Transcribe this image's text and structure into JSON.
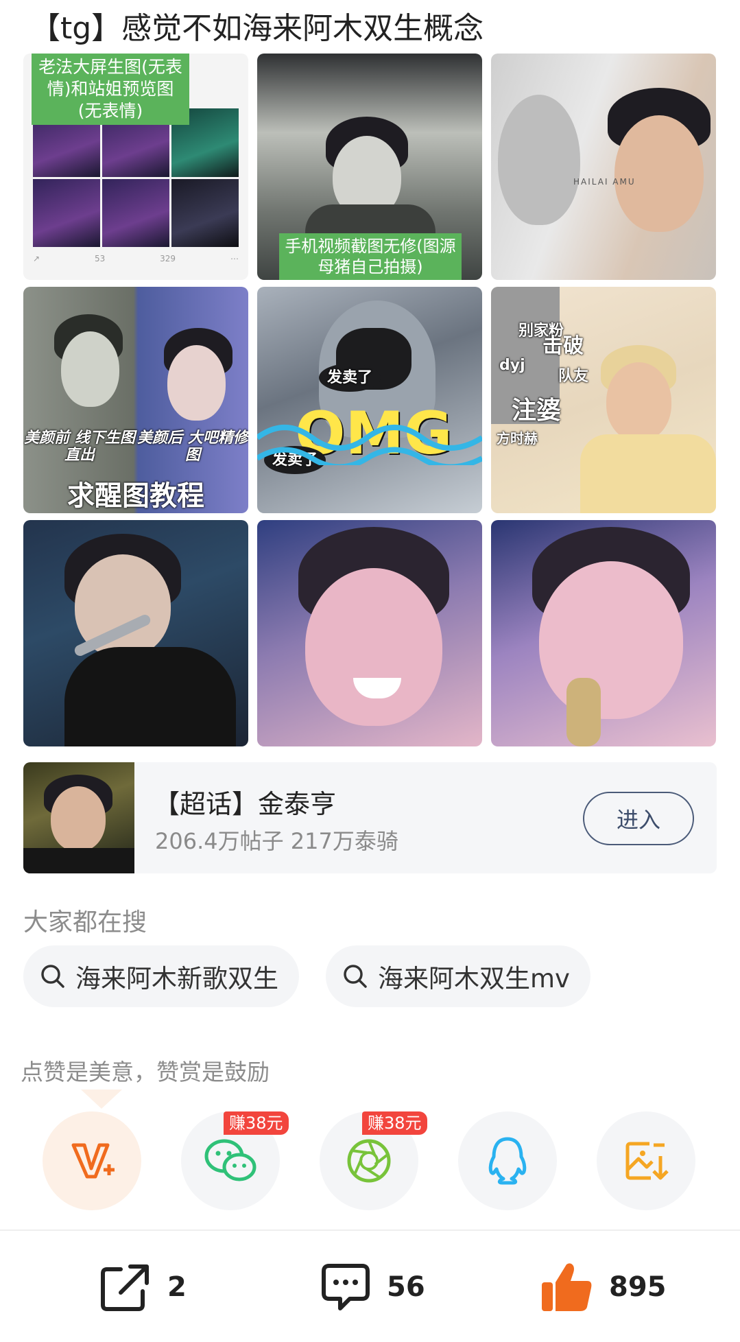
{
  "post": {
    "title": "【tg】感觉不如海来阿木双生概念"
  },
  "images": {
    "tile1": {
      "caption": "老法大屏生图(无表情)和站姐预览图(无表情)",
      "bar": [
        "53",
        "329"
      ]
    },
    "tile2": {
      "caption": "手机视频截图无修(图源母猪自己拍摄)"
    },
    "tile3": {
      "brand": "HAILAI AMU"
    },
    "tile4": {
      "label_before": "美颜前 线下生图直出",
      "label_after": "美颜后 大吧精修图",
      "banner": "求醒图教程"
    },
    "tile5": {
      "stamp": "发卖了",
      "big": "OMG"
    },
    "tile6": {
      "texts": [
        "别家粉",
        "击破",
        "dyj",
        "队友",
        "注婆",
        "方时赫"
      ]
    }
  },
  "supertopic": {
    "title": "【超话】金泰亨",
    "stats": "206.4万帖子 217万泰骑",
    "enter_label": "进入"
  },
  "search": {
    "label": "大家都在搜",
    "chips": [
      "海来阿木新歌双生",
      "海来阿木双生mv"
    ]
  },
  "reward": {
    "text": "点赞是美意，赞赏是鼓励",
    "earn_badge": "赚38元"
  },
  "actions": {
    "share_count": "2",
    "comment_count": "56",
    "like_count": "895"
  },
  "colors": {
    "accent_orange": "#f06b1e",
    "wechat_green": "#2fc178",
    "moments_green": "#78c33a",
    "qq_blue": "#2ab2f0",
    "save_orange": "#f5a623",
    "earn_red": "#f2453d"
  }
}
